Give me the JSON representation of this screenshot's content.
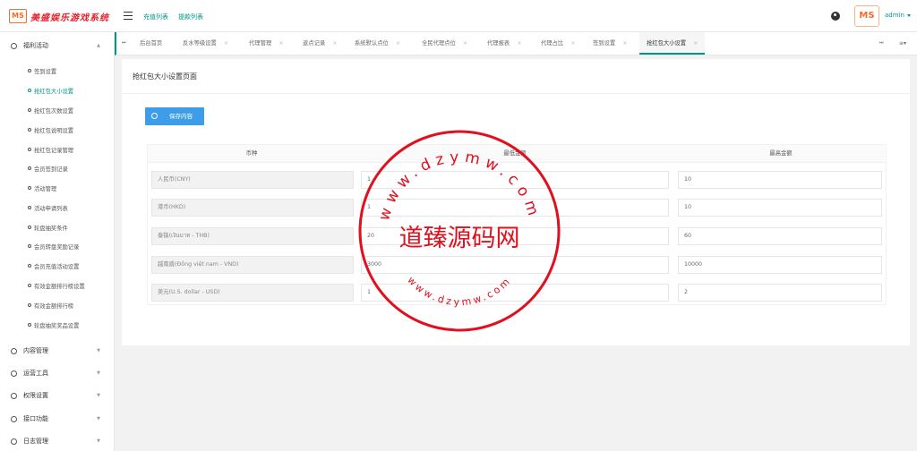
{
  "header": {
    "logo_badge": "MS",
    "logo_text": "美盛娱乐游戏系统",
    "links": [
      "充值列表",
      "提款列表"
    ],
    "avatar_text": "MS",
    "user": "admin"
  },
  "sidebar": {
    "groups": [
      {
        "label": "福利活动"
      },
      {
        "label": "内容管理"
      },
      {
        "label": "运营工具"
      },
      {
        "label": "权限设置"
      },
      {
        "label": "接口功能"
      },
      {
        "label": "日志管理"
      }
    ],
    "items": [
      "签到设置",
      "抢红包大小设置",
      "抢红包次数设置",
      "抢红包说明设置",
      "抢红包记录管理",
      "会员签到记录",
      "活动管理",
      "活动申请列表",
      "轮盘抽奖条件",
      "会员转盘奖励记录",
      "会员充值活动设置",
      "有效金额排行榜设置",
      "有效金额排行榜",
      "轮盘抽奖奖品设置"
    ],
    "active_item": 1
  },
  "tabs": [
    {
      "label": "后台首页"
    },
    {
      "label": "反水等级设置"
    },
    {
      "label": "代理管理"
    },
    {
      "label": "返点记录"
    },
    {
      "label": "系统默认点位"
    },
    {
      "label": "全民代理点位"
    },
    {
      "label": "代理报表"
    },
    {
      "label": "代理占比"
    },
    {
      "label": "签到设置"
    },
    {
      "label": "抢红包大小设置"
    }
  ],
  "page": {
    "title": "抢红包大小设置页面",
    "save_label": "保存内容"
  },
  "table": {
    "headers": [
      "币种",
      "最低金额",
      "最高金额"
    ],
    "rows": [
      {
        "currency": "人民币(CNY)",
        "min": "1",
        "max": "10"
      },
      {
        "currency": "港币(HKD)",
        "min": "1",
        "max": "10"
      },
      {
        "currency": "泰铢(เงินบาท - THB)",
        "min": "20",
        "max": "60"
      },
      {
        "currency": "越南盾(Đồng việt nam - VND)",
        "min": "3000",
        "max": "10000"
      },
      {
        "currency": "美元(U.S. dollar - USD)",
        "min": "1",
        "max": "2"
      }
    ]
  },
  "watermark": {
    "top_text": "www.dzymw.com",
    "center_text": "道臻源码网",
    "color": "#e0101e"
  }
}
